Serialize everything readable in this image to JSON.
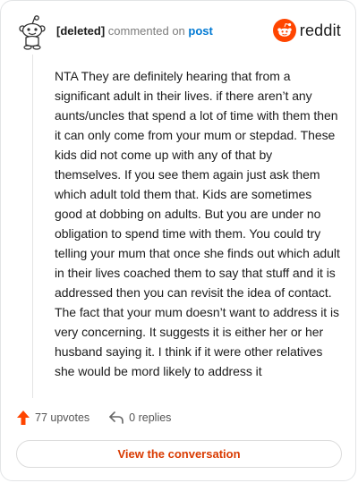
{
  "header": {
    "username": "[deleted]",
    "action": "commented on",
    "target": "post",
    "brand": "reddit",
    "avatar_icon": "reddit-snoo-avatar-icon",
    "brand_icon": "reddit-logo-icon",
    "brand_color": "#ff4500"
  },
  "comment": {
    "body": "NTA They are definitely hearing that from a significant adult in their lives. if there aren’t any aunts/uncles that spend a lot of time with them then it can only come from your mum or stepdad. These kids did not come up with any of that by themselves. If you see them again just ask them which adult told them that. Kids are sometimes good at dobbing on adults. But you are under no obligation to spend time with them. You could try telling your mum that once she finds out which adult in their lives coached them to say that stuff and it is addressed then you can revisit the idea of contact. The fact that your mum doesn’t want to address it is very concerning. It suggests it is either her or her husband saying it. I think if it were other relatives she would be mord likely to address it"
  },
  "footer": {
    "upvotes": "77 upvotes",
    "replies": "0 replies",
    "upvote_icon": "upvote-arrow-icon",
    "reply_icon": "reply-arrow-icon"
  },
  "cta": {
    "label": "View the conversation",
    "color": "#d93a00"
  }
}
